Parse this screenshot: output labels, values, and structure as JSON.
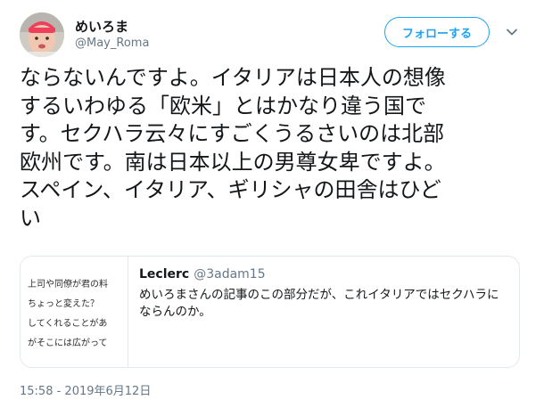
{
  "author": {
    "display_name": "めいろま",
    "handle": "@May_Roma"
  },
  "follow_button": {
    "label": "フォローする"
  },
  "caret_icon": "chevron-down-icon",
  "tweet": {
    "lines": [
      "ならないんですよ。イタリアは日本人の想像",
      "するいわゆる「欧米」とはかなり違う国で",
      "す。セクハラ云々にすごくうるさいのは北部",
      "欧州です。南は日本以上の男尊女卑ですよ。",
      "スペイン、イタリア、ギリシャの田舎はひど",
      "い"
    ]
  },
  "quote": {
    "name": "Leclerc",
    "handle": "@3adam15",
    "text_lines": [
      "めいろまさんの記事のこの部分だが、これイタリアではセクハラに",
      "ならんのか。"
    ],
    "thumbnail_lines": [
      "上司や同僚が君の料",
      "ちょっと変えた？",
      "してくれることがあ",
      "がそこには広がって"
    ]
  },
  "timestamp": "15:58 - 2019年6月12日",
  "colors": {
    "accent": "#1da1f2",
    "text": "#14171a",
    "muted": "#657786",
    "border": "#e1e8ed"
  }
}
